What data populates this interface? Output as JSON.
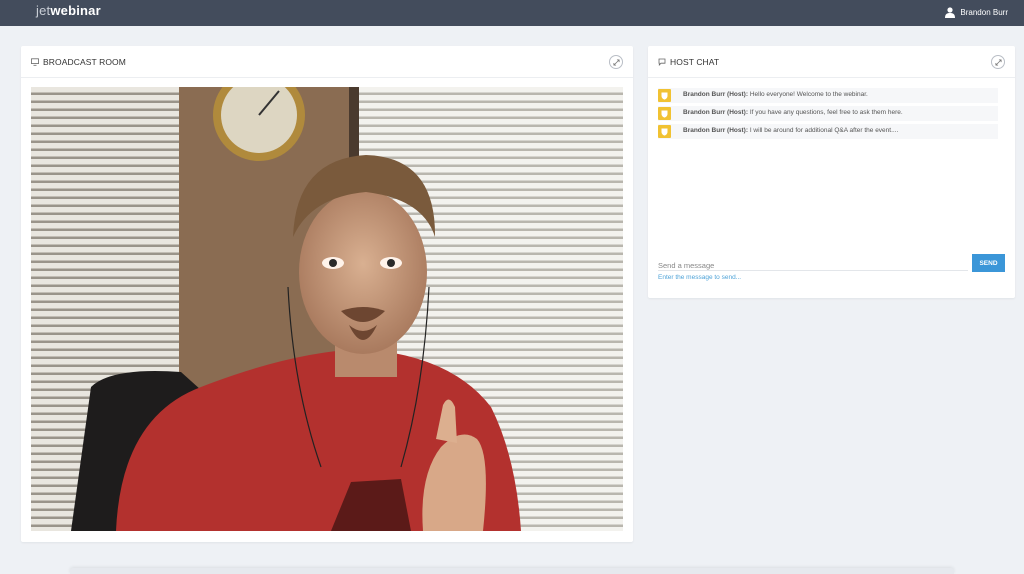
{
  "app": {
    "logo_light": "jet",
    "logo_bold": "webinar"
  },
  "user": {
    "name": "Brandon Burr",
    "icon": "user-icon"
  },
  "broadcast": {
    "title": "BROADCAST ROOM",
    "icon": "monitor-icon",
    "expand_icon": "expand-icon"
  },
  "chat": {
    "title": "HOST CHAT",
    "icon": "speech-bubble-icon",
    "expand_icon": "expand-icon",
    "messages": [
      {
        "author": "Brandon Burr (Host):",
        "text": "Hello everyone! Welcome to the webinar.",
        "badge_icon": "host-shield-icon"
      },
      {
        "author": "Brandon Burr (Host):",
        "text": "If you have any questions, feel free to ask them here.",
        "badge_icon": "host-shield-icon"
      },
      {
        "author": "Brandon Burr (Host):",
        "text": "I will be around for additional Q&A after the event....",
        "badge_icon": "host-shield-icon"
      }
    ],
    "input_placeholder": "Send a message",
    "send_label": "SEND",
    "hint": "Enter the message to send..."
  },
  "colors": {
    "topbar": "#434c5c",
    "accent": "#3b96d8",
    "host_badge": "#f1c232",
    "hint": "#4fa3d8"
  }
}
